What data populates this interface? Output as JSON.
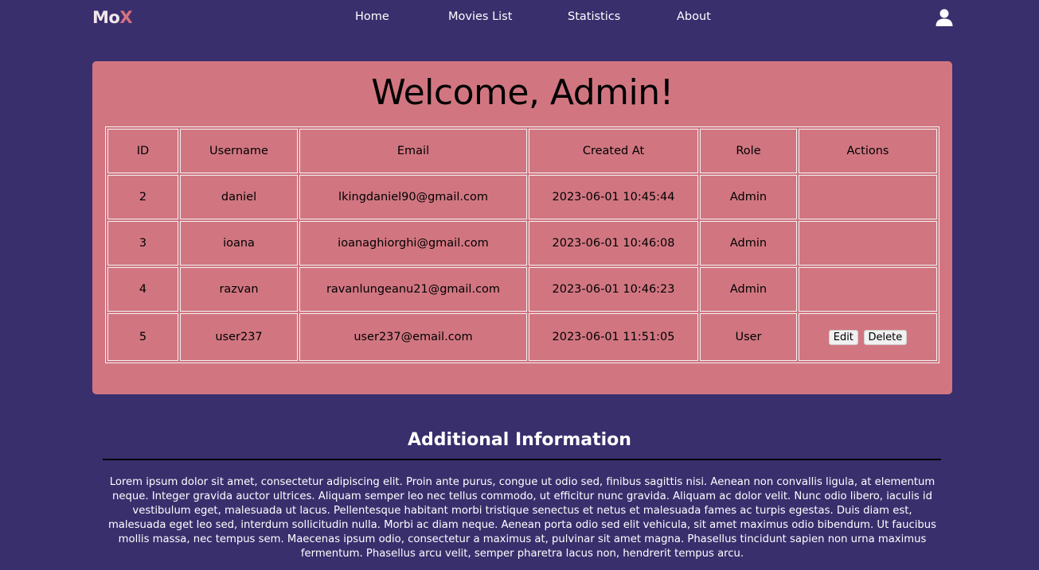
{
  "nav": {
    "logo_mo": "Mo",
    "logo_x": "X",
    "links": [
      "Home",
      "Movies List",
      "Statistics",
      "About"
    ],
    "user_icon": "user-icon"
  },
  "panel": {
    "title": "Welcome, Admin!",
    "columns": [
      "ID",
      "Username",
      "Email",
      "Created At",
      "Role",
      "Actions"
    ],
    "rows": [
      {
        "id": "2",
        "username": "daniel",
        "email": "lkingdaniel90@gmail.com",
        "created_at": "2023-06-01 10:45:44",
        "role": "Admin"
      },
      {
        "id": "3",
        "username": "ioana",
        "email": "ioanaghiorghi@gmail.com",
        "created_at": "2023-06-01 10:46:08",
        "role": "Admin"
      },
      {
        "id": "4",
        "username": "razvan",
        "email": "ravanlungeanu21@gmail.com",
        "created_at": "2023-06-01 10:46:23",
        "role": "Admin"
      },
      {
        "id": "5",
        "username": "user237",
        "email": "user237@email.com",
        "created_at": "2023-06-01 11:51:05",
        "role": "User"
      }
    ],
    "edit_label": "Edit",
    "delete_label": "Delete"
  },
  "info": {
    "title": "Additional Information",
    "text": "Lorem ipsum dolor sit amet, consectetur adipiscing elit. Proin ante purus, congue ut odio sed, finibus sagittis nisi. Aenean non convallis ligula, at elementum neque. Integer gravida auctor ultrices. Aliquam semper leo nec tellus commodo, ut efficitur nunc gravida. Aliquam ac dolor velit. Nunc odio libero, iaculis id vestibulum eget, malesuada ut lacus. Pellentesque habitant morbi tristique senectus et netus et malesuada fames ac turpis egestas. Duis diam est, malesuada eget leo sed, interdum sollicitudin nulla. Morbi ac diam neque. Aenean porta odio sed elit vehicula, sit amet maximus odio bibendum. Ut faucibus mollis massa, nec tempus sem. Maecenas ipsum odio, consectetur a maximus at, pulvinar sit amet magna. Phasellus tincidunt sapien non urna maximus fermentum. Phasellus arcu velit, semper pharetra lacus non, hendrerit tempus arcu."
  },
  "colors": {
    "background": "#392f6d",
    "panel": "#d17681",
    "logo_accent": "#d9717d"
  }
}
